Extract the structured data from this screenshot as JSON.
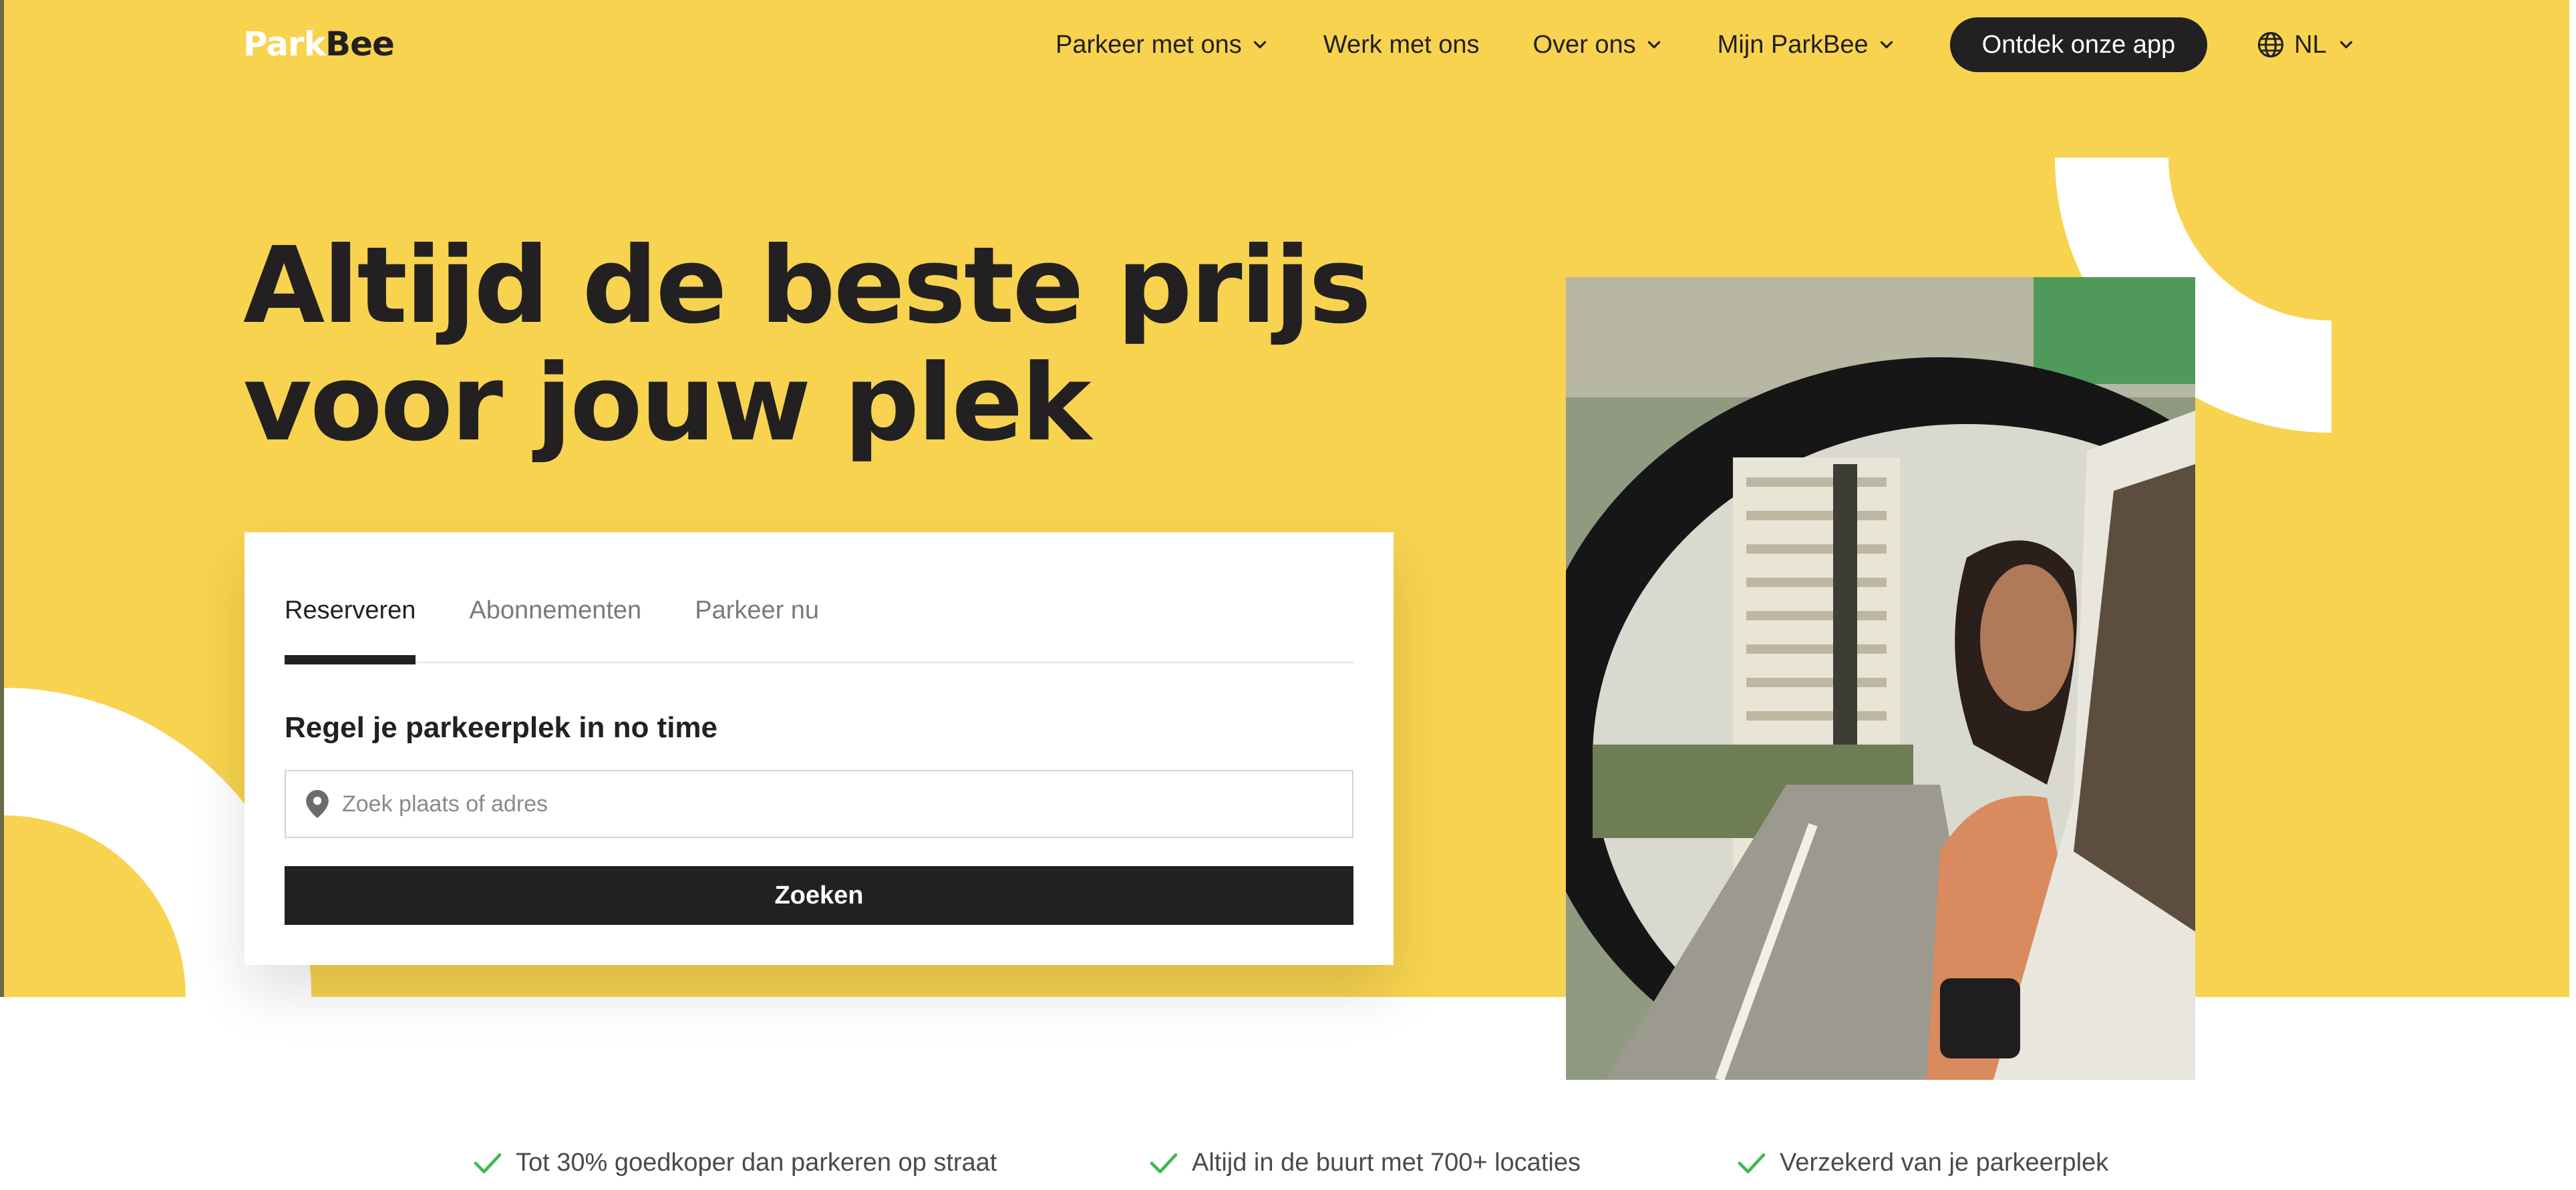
{
  "header": {
    "logo": {
      "part1": "Park",
      "part2": "Bee"
    },
    "nav": [
      {
        "label": "Parkeer met ons",
        "has_dropdown": true
      },
      {
        "label": "Werk met ons",
        "has_dropdown": false
      },
      {
        "label": "Over ons",
        "has_dropdown": true
      },
      {
        "label": "Mijn ParkBee",
        "has_dropdown": true
      }
    ],
    "app_button": "Ontdek onze app",
    "language": "NL"
  },
  "hero": {
    "headline": "Altijd de beste prijs voor jouw plek"
  },
  "search_card": {
    "tabs": [
      {
        "label": "Reserveren",
        "active": true
      },
      {
        "label": "Abonnementen",
        "active": false
      },
      {
        "label": "Parkeer nu",
        "active": false
      }
    ],
    "title": "Regel je parkeerplek in no time",
    "search_placeholder": "Zoek plaats of adres",
    "search_value": "",
    "submit_label": "Zoeken"
  },
  "usps": [
    "Tot 30% goedkoper dan parkeren op straat",
    "Altijd in de buurt met 700+ locaties",
    "Verzekerd van je parkeerplek"
  ],
  "colors": {
    "brand_yellow": "#f8d34f",
    "dark": "#222021",
    "check_green": "#3fb950"
  },
  "icons": [
    "chevron-down-icon",
    "globe-icon",
    "map-pin-icon",
    "check-icon"
  ]
}
